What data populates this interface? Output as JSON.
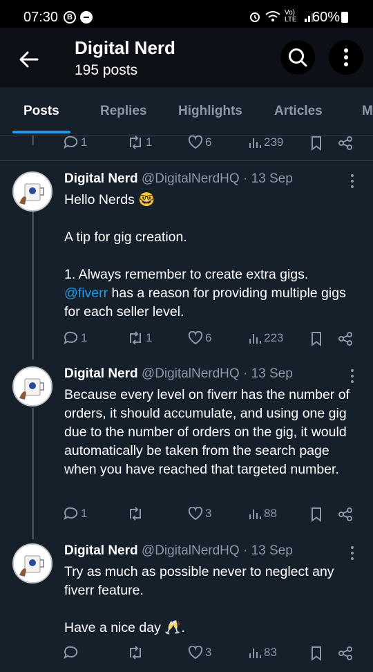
{
  "status_bar": {
    "time": "07:30",
    "b_icon": "B",
    "network": "Vo) LTE",
    "battery": "60%"
  },
  "header": {
    "title": "Digital Nerd",
    "posts_count": "195 posts"
  },
  "tabs": [
    "Posts",
    "Replies",
    "Highlights",
    "Articles",
    "M"
  ],
  "top_actions": {
    "replies": "1",
    "reposts": "1",
    "likes": "6",
    "views": "239"
  },
  "posts": [
    {
      "name": "Digital Nerd",
      "handle": "@DigitalNerdHQ",
      "date": "· 13 Sep",
      "text_1": "Hello Nerds 🤓\n\nA tip for gig creation.\n\n1. Always remember to create extra gigs.",
      "mention": "@fiverr",
      "text_2": " has a reason for providing multiple gigs for each seller level.",
      "replies": "1",
      "reposts": "1",
      "likes": "6",
      "views": "223"
    },
    {
      "name": "Digital Nerd",
      "handle": "@DigitalNerdHQ",
      "date": "· 13 Sep",
      "text": "Because every level on fiverr has the number of orders, it should accumulate, and using one gig due to the number of orders on the gig, it would automatically be taken from the search page when you have reached that targeted number.",
      "replies": "1",
      "reposts": "",
      "likes": "3",
      "views": "88"
    },
    {
      "name": "Digital Nerd",
      "handle": "@DigitalNerdHQ",
      "date": "· 13 Sep",
      "text": "Try as much as possible never to neglect any fiverr feature.\n\nHave a nice day 🥂.",
      "replies": "",
      "reposts": "",
      "likes": "3",
      "views": "83"
    }
  ],
  "colors": {
    "background": "#15202b",
    "accent": "#1d9bf0",
    "muted": "#8b98a5"
  }
}
